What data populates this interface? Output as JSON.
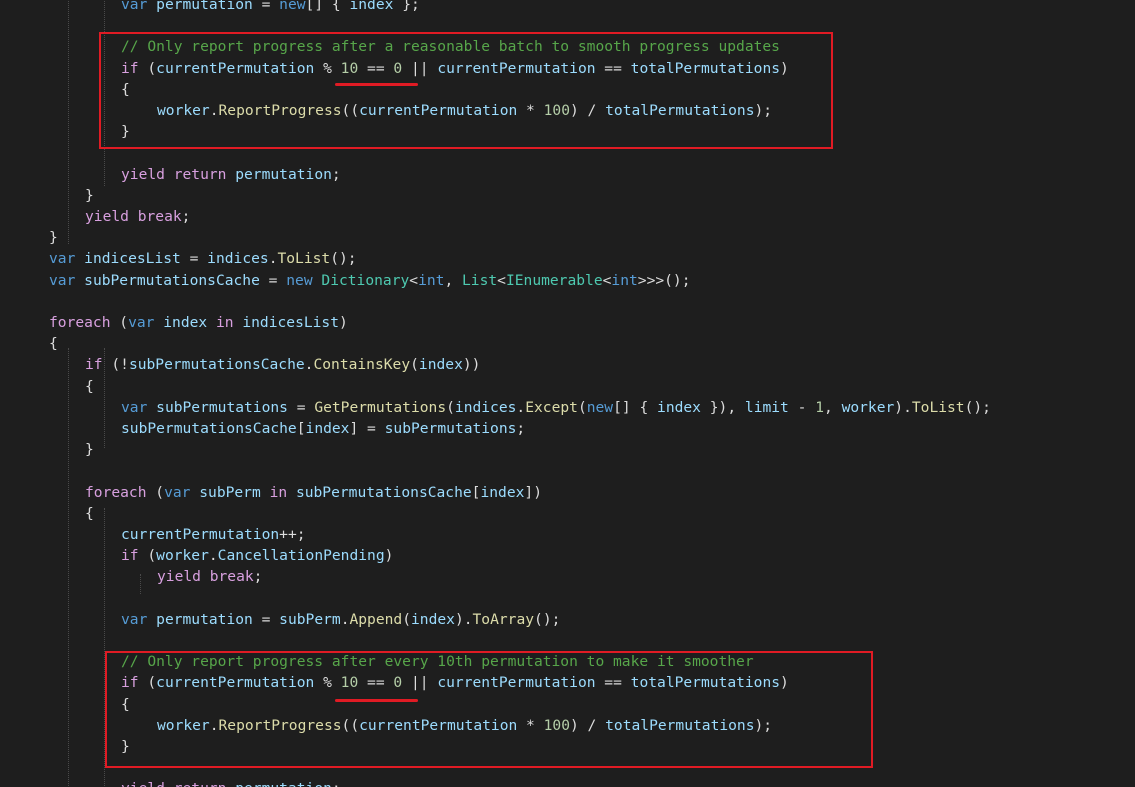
{
  "colors": {
    "background": "#1e1e1e",
    "keyword": "#569cd6",
    "control": "#d8a0df",
    "identifier": "#9cdcfe",
    "method": "#dcdcaa",
    "type": "#4ec9b0",
    "number": "#b5cea8",
    "comment": "#57a64a",
    "annotation": "#e01b24"
  },
  "code_lines": [
    [
      [
        "kw",
        "var"
      ],
      [
        "p",
        " "
      ],
      [
        "id",
        "permutation"
      ],
      [
        "p",
        " = "
      ],
      [
        "kw",
        "new"
      ],
      [
        "p",
        "[] { "
      ],
      [
        "id",
        "index"
      ],
      [
        "p",
        " };"
      ]
    ],
    [],
    [
      [
        "cmt",
        "// Only report progress after a reasonable batch to smooth progress updates"
      ]
    ],
    [
      [
        "ctl",
        "if"
      ],
      [
        "p",
        " ("
      ],
      [
        "id",
        "currentPermutation"
      ],
      [
        "p",
        " % "
      ],
      [
        "num",
        "10"
      ],
      [
        "p",
        " == "
      ],
      [
        "num",
        "0"
      ],
      [
        "p",
        " || "
      ],
      [
        "id",
        "currentPermutation"
      ],
      [
        "p",
        " == "
      ],
      [
        "id",
        "totalPermutations"
      ],
      [
        "p",
        ")"
      ]
    ],
    [
      [
        "p",
        "{"
      ]
    ],
    [
      [
        "id",
        "worker"
      ],
      [
        "p",
        "."
      ],
      [
        "m",
        "ReportProgress"
      ],
      [
        "p",
        "(("
      ],
      [
        "id",
        "currentPermutation"
      ],
      [
        "p",
        " * "
      ],
      [
        "num",
        "100"
      ],
      [
        "p",
        ") / "
      ],
      [
        "id",
        "totalPermutations"
      ],
      [
        "p",
        ");"
      ]
    ],
    [
      [
        "p",
        "}"
      ]
    ],
    [],
    [
      [
        "ctl",
        "yield"
      ],
      [
        "p",
        " "
      ],
      [
        "ctl",
        "return"
      ],
      [
        "p",
        " "
      ],
      [
        "id",
        "permutation"
      ],
      [
        "p",
        ";"
      ]
    ],
    [
      [
        "p",
        "}"
      ]
    ],
    [
      [
        "ctl",
        "yield"
      ],
      [
        "p",
        " "
      ],
      [
        "ctl",
        "break"
      ],
      [
        "p",
        ";"
      ]
    ],
    [
      [
        "p",
        "}"
      ]
    ],
    [
      [
        "kw",
        "var"
      ],
      [
        "p",
        " "
      ],
      [
        "id",
        "indicesList"
      ],
      [
        "p",
        " = "
      ],
      [
        "id",
        "indices"
      ],
      [
        "p",
        "."
      ],
      [
        "m",
        "ToList"
      ],
      [
        "p",
        "();"
      ]
    ],
    [
      [
        "kw",
        "var"
      ],
      [
        "p",
        " "
      ],
      [
        "id",
        "subPermutationsCache"
      ],
      [
        "p",
        " = "
      ],
      [
        "kw",
        "new"
      ],
      [
        "p",
        " "
      ],
      [
        "t",
        "Dictionary"
      ],
      [
        "p",
        "<"
      ],
      [
        "kw",
        "int"
      ],
      [
        "p",
        ", "
      ],
      [
        "t",
        "List"
      ],
      [
        "p",
        "<"
      ],
      [
        "t",
        "IEnumerable"
      ],
      [
        "p",
        "<"
      ],
      [
        "kw",
        "int"
      ],
      [
        "p",
        ">>>();"
      ]
    ],
    [],
    [
      [
        "ctl",
        "foreach"
      ],
      [
        "p",
        " ("
      ],
      [
        "kw",
        "var"
      ],
      [
        "p",
        " "
      ],
      [
        "id",
        "index"
      ],
      [
        "p",
        " "
      ],
      [
        "ctl",
        "in"
      ],
      [
        "p",
        " "
      ],
      [
        "id",
        "indicesList"
      ],
      [
        "p",
        ")"
      ]
    ],
    [
      [
        "p",
        "{"
      ]
    ],
    [
      [
        "ctl",
        "if"
      ],
      [
        "p",
        " (!"
      ],
      [
        "id",
        "subPermutationsCache"
      ],
      [
        "p",
        "."
      ],
      [
        "m",
        "ContainsKey"
      ],
      [
        "p",
        "("
      ],
      [
        "id",
        "index"
      ],
      [
        "p",
        "))"
      ]
    ],
    [
      [
        "p",
        "{"
      ]
    ],
    [
      [
        "kw",
        "var"
      ],
      [
        "p",
        " "
      ],
      [
        "id",
        "subPermutations"
      ],
      [
        "p",
        " = "
      ],
      [
        "m",
        "GetPermutations"
      ],
      [
        "p",
        "("
      ],
      [
        "id",
        "indices"
      ],
      [
        "p",
        "."
      ],
      [
        "m",
        "Except"
      ],
      [
        "p",
        "("
      ],
      [
        "kw",
        "new"
      ],
      [
        "p",
        "[] { "
      ],
      [
        "id",
        "index"
      ],
      [
        "p",
        " }), "
      ],
      [
        "id",
        "limit"
      ],
      [
        "p",
        " - "
      ],
      [
        "num",
        "1"
      ],
      [
        "p",
        ", "
      ],
      [
        "id",
        "worker"
      ],
      [
        "p",
        ")."
      ],
      [
        "m",
        "ToList"
      ],
      [
        "p",
        "();"
      ]
    ],
    [
      [
        "id",
        "subPermutationsCache"
      ],
      [
        "p",
        "["
      ],
      [
        "id",
        "index"
      ],
      [
        "p",
        "] = "
      ],
      [
        "id",
        "subPermutations"
      ],
      [
        "p",
        ";"
      ]
    ],
    [
      [
        "p",
        "}"
      ]
    ],
    [],
    [
      [
        "ctl",
        "foreach"
      ],
      [
        "p",
        " ("
      ],
      [
        "kw",
        "var"
      ],
      [
        "p",
        " "
      ],
      [
        "id",
        "subPerm"
      ],
      [
        "p",
        " "
      ],
      [
        "ctl",
        "in"
      ],
      [
        "p",
        " "
      ],
      [
        "id",
        "subPermutationsCache"
      ],
      [
        "p",
        "["
      ],
      [
        "id",
        "index"
      ],
      [
        "p",
        "])"
      ]
    ],
    [
      [
        "p",
        "{"
      ]
    ],
    [
      [
        "id",
        "currentPermutation"
      ],
      [
        "p",
        "++;"
      ]
    ],
    [
      [
        "ctl",
        "if"
      ],
      [
        "p",
        " ("
      ],
      [
        "id",
        "worker"
      ],
      [
        "p",
        "."
      ],
      [
        "id",
        "CancellationPending"
      ],
      [
        "p",
        ")"
      ]
    ],
    [
      [
        "ctl",
        "yield"
      ],
      [
        "p",
        " "
      ],
      [
        "ctl",
        "break"
      ],
      [
        "p",
        ";"
      ]
    ],
    [],
    [
      [
        "kw",
        "var"
      ],
      [
        "p",
        " "
      ],
      [
        "id",
        "permutation"
      ],
      [
        "p",
        " = "
      ],
      [
        "id",
        "subPerm"
      ],
      [
        "p",
        "."
      ],
      [
        "m",
        "Append"
      ],
      [
        "p",
        "("
      ],
      [
        "id",
        "index"
      ],
      [
        "p",
        ")."
      ],
      [
        "m",
        "ToArray"
      ],
      [
        "p",
        "();"
      ]
    ],
    [],
    [
      [
        "cmt",
        "// Only report progress after every 10th permutation to make it smoother"
      ]
    ],
    [
      [
        "ctl",
        "if"
      ],
      [
        "p",
        " ("
      ],
      [
        "id",
        "currentPermutation"
      ],
      [
        "p",
        " % "
      ],
      [
        "num",
        "10"
      ],
      [
        "p",
        " == "
      ],
      [
        "num",
        "0"
      ],
      [
        "p",
        " || "
      ],
      [
        "id",
        "currentPermutation"
      ],
      [
        "p",
        " == "
      ],
      [
        "id",
        "totalPermutations"
      ],
      [
        "p",
        ")"
      ]
    ],
    [
      [
        "p",
        "{"
      ]
    ],
    [
      [
        "id",
        "worker"
      ],
      [
        "p",
        "."
      ],
      [
        "m",
        "ReportProgress"
      ],
      [
        "p",
        "(("
      ],
      [
        "id",
        "currentPermutation"
      ],
      [
        "p",
        " * "
      ],
      [
        "num",
        "100"
      ],
      [
        "p",
        ") / "
      ],
      [
        "id",
        "totalPermutations"
      ],
      [
        "p",
        ");"
      ]
    ],
    [
      [
        "p",
        "}"
      ]
    ],
    [],
    [
      [
        "ctl",
        "yield"
      ],
      [
        "p",
        " "
      ],
      [
        "ctl",
        "return"
      ],
      [
        "p",
        " "
      ],
      [
        "id",
        "permutation"
      ],
      [
        "p",
        ";"
      ]
    ]
  ]
}
